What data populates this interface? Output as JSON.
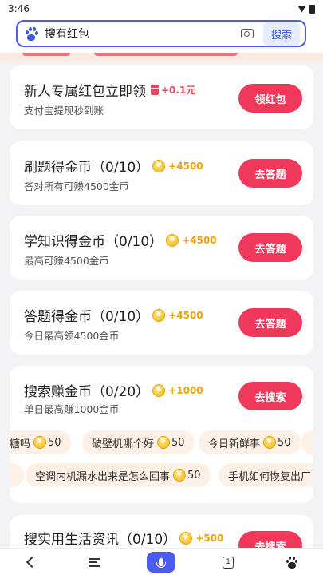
{
  "status": {
    "time": "3:46"
  },
  "search": {
    "value": "搜有红包",
    "button": "搜索"
  },
  "tasks": [
    {
      "title": "新人专属红包立即领",
      "reward": "+0.1元",
      "subtitle": "支付宝提现秒到账",
      "button": "领红包"
    },
    {
      "title": "刷题得金币（0/10）",
      "reward": "+4500",
      "subtitle": "答对所有可赚4500金币",
      "button": "去答题"
    },
    {
      "title": "学知识得金币（0/10）",
      "reward": "+4500",
      "subtitle": "最高可赚4500金币",
      "button": "去答题"
    },
    {
      "title": "答题得金币（0/10）",
      "reward": "+4500",
      "subtitle": "今日最高领4500金币",
      "button": "去答题"
    },
    {
      "title": "搜索赚金币（0/20）",
      "reward": "+1000",
      "subtitle": "单日最高赚1000金币",
      "button": "去搜索"
    },
    {
      "title": "搜实用生活资讯（0/10）",
      "reward": "+500",
      "button": "去搜索"
    }
  ],
  "suggestions_row1": [
    {
      "text": "糖吗",
      "coins": "50"
    },
    {
      "text": "破壁机哪个好",
      "coins": "50"
    },
    {
      "text": "今日新鲜事",
      "coins": "50"
    }
  ],
  "suggestions_row2": [
    {
      "text": "空调内机漏水出来是怎么回事",
      "coins": "50"
    },
    {
      "text": "手机如何恢复出厂"
    }
  ],
  "nav": {
    "tab_count": "1"
  }
}
